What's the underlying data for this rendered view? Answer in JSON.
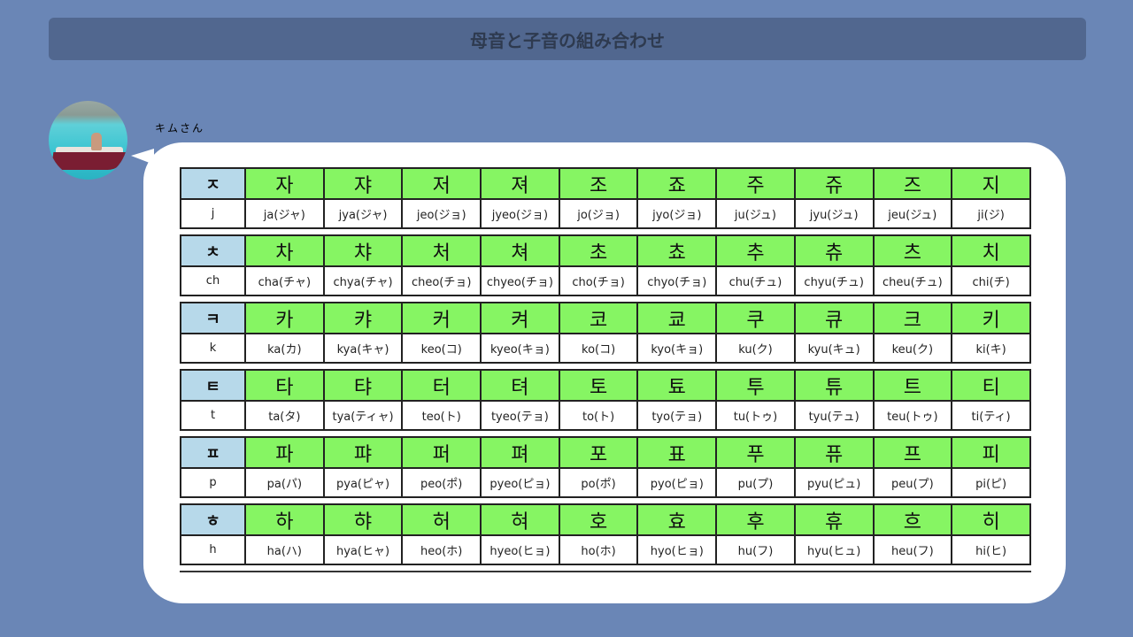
{
  "page": {
    "title": "母音と子音の組み合わせ"
  },
  "speaker": {
    "name": "キムさん"
  },
  "table": [
    {
      "consonant": "ㅈ",
      "roman": "j",
      "hangul": [
        "자",
        "쟈",
        "저",
        "져",
        "조",
        "죠",
        "주",
        "쥬",
        "즈",
        "지"
      ],
      "readings": [
        "ja(ジャ)",
        "jya(ジャ)",
        "jeo(ジョ)",
        "jyeo(ジョ)",
        "jo(ジョ)",
        "jyo(ジョ)",
        "ju(ジュ)",
        "jyu(ジュ)",
        "jeu(ジュ)",
        "ji(ジ)"
      ]
    },
    {
      "consonant": "ㅊ",
      "roman": "ch",
      "hangul": [
        "차",
        "챠",
        "처",
        "쳐",
        "초",
        "쵸",
        "추",
        "츄",
        "츠",
        "치"
      ],
      "readings": [
        "cha(チャ)",
        "chya(チャ)",
        "cheo(チョ)",
        "chyeo(チョ)",
        "cho(チョ)",
        "chyo(チョ)",
        "chu(チュ)",
        "chyu(チュ)",
        "cheu(チュ)",
        "chi(チ)"
      ]
    },
    {
      "consonant": "ㅋ",
      "roman": "k",
      "hangul": [
        "카",
        "캬",
        "커",
        "켜",
        "코",
        "쿄",
        "쿠",
        "큐",
        "크",
        "키"
      ],
      "readings": [
        "ka(カ)",
        "kya(キャ)",
        "keo(コ)",
        "kyeo(キョ)",
        "ko(コ)",
        "kyo(キョ)",
        "ku(ク)",
        "kyu(キュ)",
        "keu(ク)",
        "ki(キ)"
      ]
    },
    {
      "consonant": "ㅌ",
      "roman": "t",
      "hangul": [
        "타",
        "탸",
        "터",
        "텨",
        "토",
        "툐",
        "투",
        "튜",
        "트",
        "티"
      ],
      "readings": [
        "ta(タ)",
        "tya(ティャ)",
        "teo(ト)",
        "tyeo(テョ)",
        "to(ト)",
        "tyo(テョ)",
        "tu(トゥ)",
        "tyu(テュ)",
        "teu(トゥ)",
        "ti(ティ)"
      ]
    },
    {
      "consonant": "ㅍ",
      "roman": "p",
      "hangul": [
        "파",
        "퍄",
        "퍼",
        "펴",
        "포",
        "표",
        "푸",
        "퓨",
        "프",
        "피"
      ],
      "readings": [
        "pa(パ)",
        "pya(ピャ)",
        "peo(ポ)",
        "pyeo(ピョ)",
        "po(ポ)",
        "pyo(ピョ)",
        "pu(プ)",
        "pyu(ピュ)",
        "peu(プ)",
        "pi(ピ)"
      ]
    },
    {
      "consonant": "ㅎ",
      "roman": "h",
      "hangul": [
        "하",
        "햐",
        "허",
        "혀",
        "호",
        "효",
        "후",
        "휴",
        "흐",
        "히"
      ],
      "readings": [
        "ha(ハ)",
        "hya(ヒャ)",
        "heo(ホ)",
        "hyeo(ヒョ)",
        "ho(ホ)",
        "hyo(ヒョ)",
        "hu(フ)",
        "hyu(ヒュ)",
        "heu(フ)",
        "hi(ヒ)"
      ]
    }
  ],
  "colors": {
    "background": "#6a86b6",
    "title_bar": "#51678f",
    "hangul_cell": "#86f563",
    "consonant_cell": "#b7d9ea"
  }
}
